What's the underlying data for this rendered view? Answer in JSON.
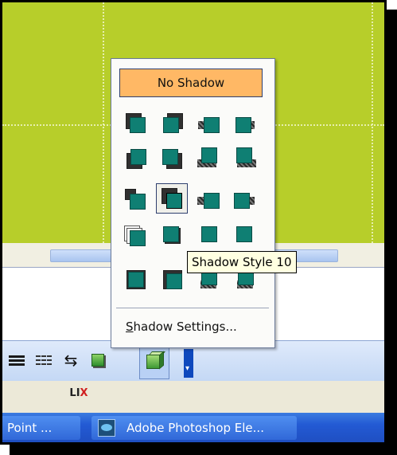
{
  "shadow_menu": {
    "no_shadow_label": "No Shadow",
    "settings_label_first": "S",
    "settings_label_rest": "hadow Settings...",
    "highlighted_style": "Shadow Style 10"
  },
  "tooltip": {
    "text": "Shadow Style 10"
  },
  "toolbar": {
    "icons": [
      "line-style-icon",
      "dash-style-icon",
      "arrow-style-icon",
      "shadow-style-icon",
      "3d-style-icon",
      "toolbar-options-icon"
    ]
  },
  "status": {
    "icon": "spelling-error-icon",
    "icon_text": "LIX"
  },
  "taskbar": {
    "items": [
      {
        "label": "Point ..."
      },
      {
        "label": "Adobe Photoshop Ele..."
      }
    ]
  },
  "colors": {
    "slide_background": "#b7ce2a",
    "no_shadow_highlight": "#ffb865",
    "shape_fill": "#0f7f73",
    "taskbar": "#235ad4"
  }
}
